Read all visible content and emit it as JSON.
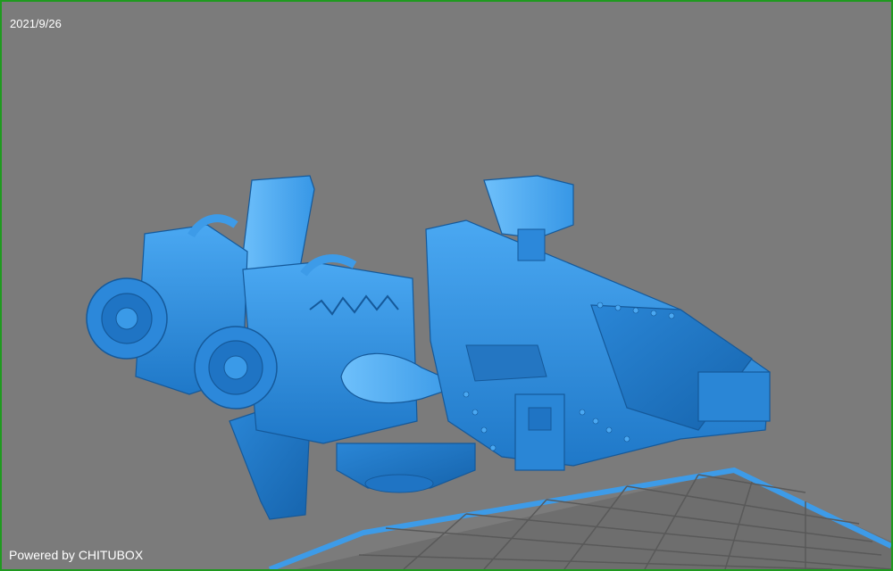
{
  "viewport": {
    "date": "2021/9/26",
    "powered_by": "Powered by CHITUBOX"
  },
  "colors": {
    "background": "#7b7b7b",
    "border": "#1f9a1f",
    "model": "#2f8fe0",
    "model_shadow": "#1b6fb8",
    "model_highlight": "#5ab3f7",
    "build_plate_border": "#3d9be8",
    "build_plate_grid": "#5a5a5a"
  },
  "icons": {
    "model": "3d-model-preview",
    "build_plate": "build-plate-grid"
  }
}
